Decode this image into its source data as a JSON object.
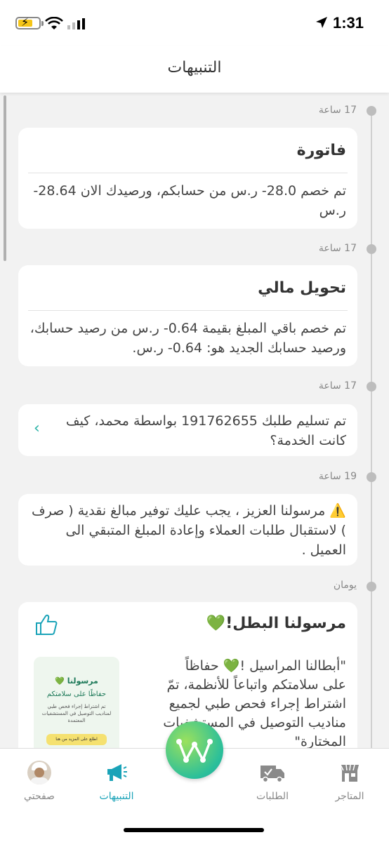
{
  "status_bar": {
    "time": "1:31"
  },
  "header": {
    "title": "التنبيهات"
  },
  "notifications": [
    {
      "time": "17 ساعة",
      "title": "فاتورة",
      "body": "تم خصم 28.0- ر.س من حسابكم، ورصيدك الان 28.64- ر.س"
    },
    {
      "time": "17 ساعة",
      "title": "تحويل مالي",
      "body": "تم خصم باقي المبلغ بقيمة 0.64- ر.س من رصيد حسابك، ورصيد حسابك الجديد هو: 0.64- ر.س."
    },
    {
      "time": "17 ساعة",
      "body": "تم تسليم طلبك 191762655 بواسطة محمد، كيف كانت الخدمة؟"
    },
    {
      "time": "19 ساعة",
      "body": "⚠️ مرسولنا العزيز ، يجب عليك توفير مبالغ نقدية ( صرف ) لاستقبال طلبات العملاء وإعادة المبلغ المتبقي الى العميل ."
    },
    {
      "time": "يومان",
      "title": "مرسولنا البطل!💚",
      "body": "\"أبطالنا المراسيل !💚 حفاظاً على سلامتكم واتباعاً للأنظمة، تمّ اشتراط إجراء فحص طبي لجميع مناديب التوصيل في المستشفيات المختارة\""
    }
  ],
  "promo_image": {
    "heading": "مرسولنا 💚",
    "line1": "حفاظًا على سلامتكم",
    "line2": "تم اشتراط إجراء فحص طبي لمناديب التوصيل في المستشفيات المعتمدة",
    "button": "اطلع على المزيد من هنا"
  },
  "nav": {
    "stores": "المتاجر",
    "orders": "الطلبات",
    "notifications": "التنبيهات",
    "profile": "صفحتي"
  },
  "colors": {
    "accent": "#1aa3b8",
    "fab": "#2bbf9a"
  }
}
